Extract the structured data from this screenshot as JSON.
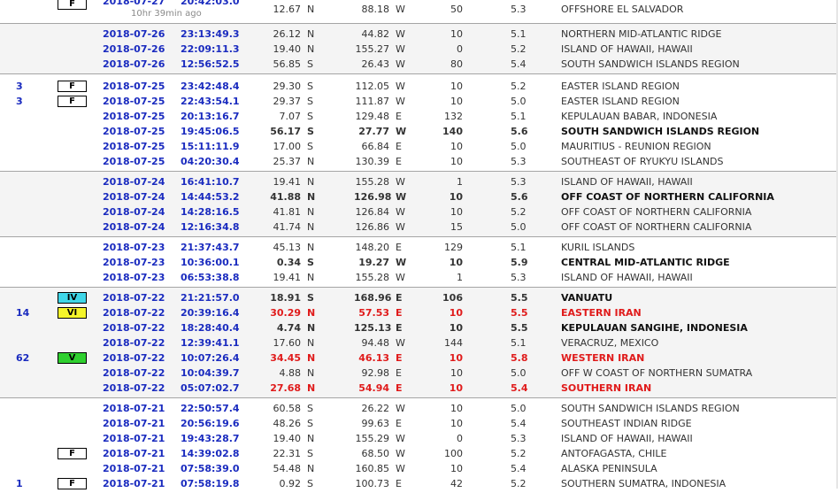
{
  "groups": [
    {
      "rows": [
        {
          "felt": "",
          "intensity": "F",
          "intensity_class": "f",
          "date": "2018-07-27",
          "time": "20:42:03.0",
          "ago": "10hr 39min ago",
          "lat": "12.67",
          "ns": "N",
          "lon": "88.18",
          "ew": "W",
          "depth": "50",
          "mag": "5.3",
          "region": "OFFSHORE EL SALVADOR",
          "style": ""
        }
      ]
    },
    {
      "rows": [
        {
          "felt": "",
          "intensity": "",
          "intensity_class": "",
          "date": "2018-07-26",
          "time": "23:13:49.3",
          "ago": "",
          "lat": "26.12",
          "ns": "N",
          "lon": "44.82",
          "ew": "W",
          "depth": "10",
          "mag": "5.1",
          "region": "NORTHERN MID-ATLANTIC RIDGE",
          "style": ""
        },
        {
          "felt": "",
          "intensity": "",
          "intensity_class": "",
          "date": "2018-07-26",
          "time": "22:09:11.3",
          "ago": "",
          "lat": "19.40",
          "ns": "N",
          "lon": "155.27",
          "ew": "W",
          "depth": "0",
          "mag": "5.2",
          "region": "ISLAND OF HAWAII, HAWAII",
          "style": ""
        },
        {
          "felt": "",
          "intensity": "",
          "intensity_class": "",
          "date": "2018-07-26",
          "time": "12:56:52.5",
          "ago": "",
          "lat": "56.85",
          "ns": "S",
          "lon": "26.43",
          "ew": "W",
          "depth": "80",
          "mag": "5.4",
          "region": "SOUTH SANDWICH ISLANDS REGION",
          "style": ""
        }
      ]
    },
    {
      "rows": [
        {
          "felt": "3",
          "intensity": "F",
          "intensity_class": "f",
          "date": "2018-07-25",
          "time": "23:42:48.4",
          "ago": "",
          "lat": "29.30",
          "ns": "S",
          "lon": "112.05",
          "ew": "W",
          "depth": "10",
          "mag": "5.2",
          "region": "EASTER ISLAND REGION",
          "style": ""
        },
        {
          "felt": "3",
          "intensity": "F",
          "intensity_class": "f",
          "date": "2018-07-25",
          "time": "22:43:54.1",
          "ago": "",
          "lat": "29.37",
          "ns": "S",
          "lon": "111.87",
          "ew": "W",
          "depth": "10",
          "mag": "5.0",
          "region": "EASTER ISLAND REGION",
          "style": ""
        },
        {
          "felt": "",
          "intensity": "",
          "intensity_class": "",
          "date": "2018-07-25",
          "time": "20:13:16.7",
          "ago": "",
          "lat": "7.07",
          "ns": "S",
          "lon": "129.48",
          "ew": "E",
          "depth": "132",
          "mag": "5.1",
          "region": "KEPULAUAN BABAR, INDONESIA",
          "style": ""
        },
        {
          "felt": "",
          "intensity": "",
          "intensity_class": "",
          "date": "2018-07-25",
          "time": "19:45:06.5",
          "ago": "",
          "lat": "56.17",
          "ns": "S",
          "lon": "27.77",
          "ew": "W",
          "depth": "140",
          "mag": "5.6",
          "region": "SOUTH SANDWICH ISLANDS REGION",
          "style": "b"
        },
        {
          "felt": "",
          "intensity": "",
          "intensity_class": "",
          "date": "2018-07-25",
          "time": "15:11:11.9",
          "ago": "",
          "lat": "17.00",
          "ns": "S",
          "lon": "66.84",
          "ew": "E",
          "depth": "10",
          "mag": "5.0",
          "region": "MAURITIUS - REUNION REGION",
          "style": ""
        },
        {
          "felt": "",
          "intensity": "",
          "intensity_class": "",
          "date": "2018-07-25",
          "time": "04:20:30.4",
          "ago": "",
          "lat": "25.37",
          "ns": "N",
          "lon": "130.39",
          "ew": "E",
          "depth": "10",
          "mag": "5.3",
          "region": "SOUTHEAST OF RYUKYU ISLANDS",
          "style": ""
        }
      ]
    },
    {
      "rows": [
        {
          "felt": "",
          "intensity": "",
          "intensity_class": "",
          "date": "2018-07-24",
          "time": "16:41:10.7",
          "ago": "",
          "lat": "19.41",
          "ns": "N",
          "lon": "155.28",
          "ew": "W",
          "depth": "1",
          "mag": "5.3",
          "region": "ISLAND OF HAWAII, HAWAII",
          "style": ""
        },
        {
          "felt": "",
          "intensity": "",
          "intensity_class": "",
          "date": "2018-07-24",
          "time": "14:44:53.2",
          "ago": "",
          "lat": "41.88",
          "ns": "N",
          "lon": "126.98",
          "ew": "W",
          "depth": "10",
          "mag": "5.6",
          "region": "OFF COAST OF NORTHERN CALIFORNIA",
          "style": "b"
        },
        {
          "felt": "",
          "intensity": "",
          "intensity_class": "",
          "date": "2018-07-24",
          "time": "14:28:16.5",
          "ago": "",
          "lat": "41.81",
          "ns": "N",
          "lon": "126.84",
          "ew": "W",
          "depth": "10",
          "mag": "5.2",
          "region": "OFF COAST OF NORTHERN CALIFORNIA",
          "style": ""
        },
        {
          "felt": "",
          "intensity": "",
          "intensity_class": "",
          "date": "2018-07-24",
          "time": "12:16:34.8",
          "ago": "",
          "lat": "41.74",
          "ns": "N",
          "lon": "126.86",
          "ew": "W",
          "depth": "15",
          "mag": "5.0",
          "region": "OFF COAST OF NORTHERN CALIFORNIA",
          "style": ""
        }
      ]
    },
    {
      "rows": [
        {
          "felt": "",
          "intensity": "",
          "intensity_class": "",
          "date": "2018-07-23",
          "time": "21:37:43.7",
          "ago": "",
          "lat": "45.13",
          "ns": "N",
          "lon": "148.20",
          "ew": "E",
          "depth": "129",
          "mag": "5.1",
          "region": "KURIL ISLANDS",
          "style": ""
        },
        {
          "felt": "",
          "intensity": "",
          "intensity_class": "",
          "date": "2018-07-23",
          "time": "10:36:00.1",
          "ago": "",
          "lat": "0.34",
          "ns": "S",
          "lon": "19.27",
          "ew": "W",
          "depth": "10",
          "mag": "5.9",
          "region": "CENTRAL MID-ATLANTIC RIDGE",
          "style": "b"
        },
        {
          "felt": "",
          "intensity": "",
          "intensity_class": "",
          "date": "2018-07-23",
          "time": "06:53:38.8",
          "ago": "",
          "lat": "19.41",
          "ns": "N",
          "lon": "155.28",
          "ew": "W",
          "depth": "1",
          "mag": "5.3",
          "region": "ISLAND OF HAWAII, HAWAII",
          "style": ""
        }
      ]
    },
    {
      "rows": [
        {
          "felt": "",
          "intensity": "IV",
          "intensity_class": "iv",
          "date": "2018-07-22",
          "time": "21:21:57.0",
          "ago": "",
          "lat": "18.91",
          "ns": "S",
          "lon": "168.96",
          "ew": "E",
          "depth": "106",
          "mag": "5.5",
          "region": "VANUATU",
          "style": "b"
        },
        {
          "felt": "14",
          "intensity": "VI",
          "intensity_class": "vi",
          "date": "2018-07-22",
          "time": "20:39:16.4",
          "ago": "",
          "lat": "30.29",
          "ns": "N",
          "lon": "57.53",
          "ew": "E",
          "depth": "10",
          "mag": "5.5",
          "region": "EASTERN IRAN",
          "style": "r"
        },
        {
          "felt": "",
          "intensity": "",
          "intensity_class": "",
          "date": "2018-07-22",
          "time": "18:28:40.4",
          "ago": "",
          "lat": "4.74",
          "ns": "N",
          "lon": "125.13",
          "ew": "E",
          "depth": "10",
          "mag": "5.5",
          "region": "KEPULAUAN SANGIHE, INDONESIA",
          "style": "b"
        },
        {
          "felt": "",
          "intensity": "",
          "intensity_class": "",
          "date": "2018-07-22",
          "time": "12:39:41.1",
          "ago": "",
          "lat": "17.60",
          "ns": "N",
          "lon": "94.48",
          "ew": "W",
          "depth": "144",
          "mag": "5.1",
          "region": "VERACRUZ, MEXICO",
          "style": ""
        },
        {
          "felt": "62",
          "intensity": "V",
          "intensity_class": "v",
          "date": "2018-07-22",
          "time": "10:07:26.4",
          "ago": "",
          "lat": "34.45",
          "ns": "N",
          "lon": "46.13",
          "ew": "E",
          "depth": "10",
          "mag": "5.8",
          "region": "WESTERN IRAN",
          "style": "r"
        },
        {
          "felt": "",
          "intensity": "",
          "intensity_class": "",
          "date": "2018-07-22",
          "time": "10:04:39.7",
          "ago": "",
          "lat": "4.88",
          "ns": "N",
          "lon": "92.98",
          "ew": "E",
          "depth": "10",
          "mag": "5.0",
          "region": "OFF W COAST OF NORTHERN SUMATRA",
          "style": ""
        },
        {
          "felt": "",
          "intensity": "",
          "intensity_class": "",
          "date": "2018-07-22",
          "time": "05:07:02.7",
          "ago": "",
          "lat": "27.68",
          "ns": "N",
          "lon": "54.94",
          "ew": "E",
          "depth": "10",
          "mag": "5.4",
          "region": "SOUTHERN IRAN",
          "style": "r"
        }
      ]
    },
    {
      "rows": [
        {
          "felt": "",
          "intensity": "",
          "intensity_class": "",
          "date": "2018-07-21",
          "time": "22:50:57.4",
          "ago": "",
          "lat": "60.58",
          "ns": "S",
          "lon": "26.22",
          "ew": "W",
          "depth": "10",
          "mag": "5.0",
          "region": "SOUTH SANDWICH ISLANDS REGION",
          "style": ""
        },
        {
          "felt": "",
          "intensity": "",
          "intensity_class": "",
          "date": "2018-07-21",
          "time": "20:56:19.6",
          "ago": "",
          "lat": "48.26",
          "ns": "S",
          "lon": "99.63",
          "ew": "E",
          "depth": "10",
          "mag": "5.4",
          "region": "SOUTHEAST INDIAN RIDGE",
          "style": ""
        },
        {
          "felt": "",
          "intensity": "",
          "intensity_class": "",
          "date": "2018-07-21",
          "time": "19:43:28.7",
          "ago": "",
          "lat": "19.40",
          "ns": "N",
          "lon": "155.29",
          "ew": "W",
          "depth": "0",
          "mag": "5.3",
          "region": "ISLAND OF HAWAII, HAWAII",
          "style": ""
        },
        {
          "felt": "",
          "intensity": "F",
          "intensity_class": "f",
          "date": "2018-07-21",
          "time": "14:39:02.8",
          "ago": "",
          "lat": "22.31",
          "ns": "S",
          "lon": "68.50",
          "ew": "W",
          "depth": "100",
          "mag": "5.2",
          "region": "ANTOFAGASTA, CHILE",
          "style": ""
        },
        {
          "felt": "",
          "intensity": "",
          "intensity_class": "",
          "date": "2018-07-21",
          "time": "07:58:39.0",
          "ago": "",
          "lat": "54.48",
          "ns": "N",
          "lon": "160.85",
          "ew": "W",
          "depth": "10",
          "mag": "5.4",
          "region": "ALASKA PENINSULA",
          "style": ""
        },
        {
          "felt": "1",
          "intensity": "F",
          "intensity_class": "f",
          "date": "2018-07-21",
          "time": "07:58:19.8",
          "ago": "",
          "lat": "0.92",
          "ns": "S",
          "lon": "100.73",
          "ew": "E",
          "depth": "42",
          "mag": "5.2",
          "region": "SOUTHERN SUMATRA, INDONESIA",
          "style": ""
        }
      ]
    }
  ]
}
